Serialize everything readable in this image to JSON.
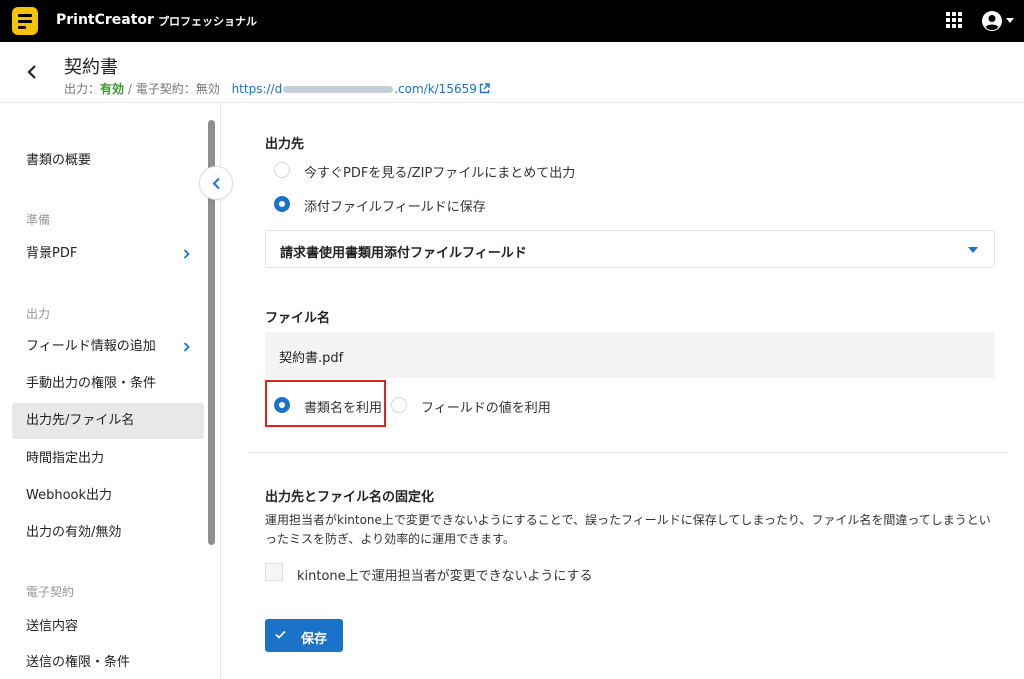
{
  "app": {
    "name": "PrintCreator",
    "plan": "プロフェッショナル"
  },
  "header": {
    "title": "契約書",
    "output_label": "出力：",
    "output_value": "有効",
    "separator": " / ",
    "esign_label": "電子契約：",
    "esign_value": "無効",
    "url_prefix": "https://d",
    "url_suffix": ".com/k/15659"
  },
  "sidebar": {
    "overview": "書類の概要",
    "section_prep": "準備",
    "background_pdf": "背景PDF",
    "section_output": "出力",
    "add_field_info": "フィールド情報の追加",
    "manual_output": "手動出力の権限・条件",
    "destination_filename": "出力先/ファイル名",
    "scheduled_output": "時間指定出力",
    "webhook_output": "Webhook出力",
    "output_toggle": "出力の有効/無効",
    "section_esign": "電子契約",
    "send_content": "送信内容",
    "send_permissions": "送信の権限・条件"
  },
  "main": {
    "destination_title": "出力先",
    "option_pdf_zip": "今すぐPDFを見る/ZIPファイルにまとめて出力",
    "option_attach_field": "添付ファイルフィールドに保存",
    "attach_field_select": "請求書使用書類用添付ファイルフィールド",
    "filename_title": "ファイル名",
    "filename_value": "契約書.pdf",
    "option_doc_name": "書類名を利用",
    "option_field_value": "フィールドの値を利用",
    "lock_title": "出力先とファイル名の固定化",
    "lock_desc": "運用担当者がkintone上で変更できないようにすることで、誤ったフィールドに保存してしまったり、ファイル名を間違ってしまうといったミスを防ぎ、より効率的に運用できます。",
    "lock_checkbox": "kintone上で運用担当者が変更できないようにする",
    "save_label": "保存"
  },
  "state": {
    "destination_selected": "添付ファイルフィールドに保存",
    "filename_mode_selected": "書類名を利用",
    "lock_checked": false,
    "active_nav": "出力先/ファイル名"
  },
  "colors": {
    "accent": "#1a73c8",
    "enabled_text": "#3a9a2a",
    "highlight": "#e0231c",
    "logo": "#f5c400"
  }
}
